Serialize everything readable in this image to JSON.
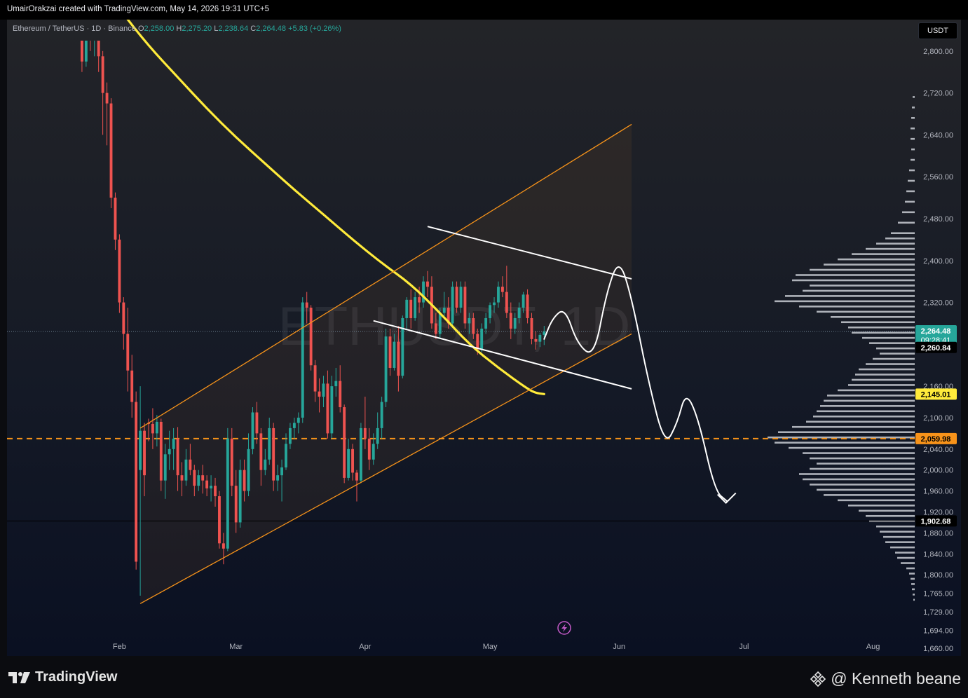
{
  "header": {
    "attribution": "UmairOrakzai created with TradingView.com, May 14, 2026 19:31 UTC+5"
  },
  "legend": {
    "symbol": "Ethereum / TetherUS · 1D · Binance",
    "o_label": "O",
    "o_value": "2,258.00",
    "h_label": "H",
    "h_value": "2,275.20",
    "l_label": "L",
    "l_value": "2,238.64",
    "c_label": "C",
    "c_value": "2,264.48",
    "change": "+5.83 (+0.26%)"
  },
  "currency": "USDT",
  "watermark": "ETHUSDT, 1D",
  "footer": {
    "brand": "TradingView",
    "credit": "@ Kenneth beane"
  },
  "colors": {
    "up": "#26a69a",
    "down": "#ef5350",
    "ma": "#ffeb3b",
    "channel": "#f7931a",
    "level": "#f7931a",
    "current": "#26a69a"
  },
  "chart_data": {
    "type": "candlestick",
    "symbol": "ETHUSDT",
    "interval": "1D",
    "ylim": [
      1645,
      2860
    ],
    "x_range": [
      "Jan 5",
      "Aug 11"
    ],
    "y_ticks": [
      "2,800.00",
      "2,720.00",
      "2,640.00",
      "2,560.00",
      "2,480.00",
      "2,400.00",
      "2,320.00",
      "2,160.00",
      "2,100.00",
      "2,040.00",
      "2,000.00",
      "1,960.00",
      "1,920.00",
      "1,880.00",
      "1,840.00",
      "1,800.00",
      "1,765.00",
      "1,729.00",
      "1,694.00",
      "1,660.00"
    ],
    "x_ticks": [
      "Feb",
      "Mar",
      "Apr",
      "May",
      "Jun",
      "Jul",
      "Aug"
    ],
    "price_labels": [
      {
        "value": "2,264.48",
        "sub": "09:28:41",
        "kind": "current"
      },
      {
        "value": "2,260.84",
        "kind": "black"
      },
      {
        "value": "2,145.01",
        "kind": "ma"
      },
      {
        "value": "2,059.98",
        "kind": "level"
      },
      {
        "value": "1,902.68",
        "kind": "black"
      }
    ],
    "levels": {
      "dashed": 2059.98,
      "solid": 1902.68,
      "current": 2264.48
    },
    "candles": [
      [
        "Jan 20",
        2870,
        2930,
        2840,
        2900
      ],
      [
        "Jan 21",
        2900,
        2940,
        2820,
        2850
      ],
      [
        "Jan 22",
        2850,
        2900,
        2830,
        2880
      ],
      [
        "Jan 23",
        2880,
        2920,
        2760,
        2780
      ],
      [
        "Jan 24",
        2780,
        2900,
        2770,
        2880
      ],
      [
        "Jan 25",
        2880,
        2900,
        2800,
        2820
      ],
      [
        "Jan 26",
        2820,
        2880,
        2790,
        2860
      ],
      [
        "Jan 27",
        2860,
        2870,
        2760,
        2790
      ],
      [
        "Jan 28",
        2790,
        2800,
        2640,
        2720
      ],
      [
        "Jan 29",
        2720,
        2740,
        2620,
        2700
      ],
      [
        "Jan 30",
        2700,
        2710,
        2500,
        2520
      ],
      [
        "Jan 31",
        2520,
        2530,
        2420,
        2440
      ],
      [
        "Feb 1",
        2440,
        2450,
        2300,
        2320
      ],
      [
        "Feb 2",
        2320,
        2330,
        2230,
        2260
      ],
      [
        "Feb 3",
        2260,
        2310,
        2150,
        2190
      ],
      [
        "Feb 4",
        2190,
        2220,
        2100,
        2130
      ],
      [
        "Feb 5",
        2130,
        2150,
        1810,
        1825
      ],
      [
        "Feb 6",
        2000,
        2160,
        1760,
        2075
      ],
      [
        "Feb 7",
        2075,
        2090,
        1950,
        1990
      ],
      [
        "Feb 8",
        2090,
        2098,
        2055,
        2088
      ],
      [
        "Feb 9",
        2088,
        2118,
        2040,
        2070
      ],
      [
        "Feb 10",
        2070,
        2105,
        2045,
        2092
      ],
      [
        "Feb 11",
        2092,
        2098,
        1960,
        1980
      ],
      [
        "Feb 12",
        1980,
        2050,
        1945,
        2030
      ],
      [
        "Feb 13",
        2030,
        2075,
        2000,
        2040
      ],
      [
        "Feb 14",
        2040,
        2080,
        2000,
        2060
      ],
      [
        "Feb 15",
        2060,
        2082,
        1960,
        1990
      ],
      [
        "Feb 16",
        1990,
        2015,
        1950,
        1980
      ],
      [
        "Feb 17",
        1980,
        2040,
        1970,
        2020
      ],
      [
        "Feb 18",
        2020,
        2050,
        1990,
        2000
      ],
      [
        "Feb 19",
        2000,
        2010,
        1950,
        1970
      ],
      [
        "Feb 20",
        1970,
        2000,
        1960,
        1990
      ],
      [
        "Feb 21",
        1990,
        2010,
        1955,
        1980
      ],
      [
        "Feb 22",
        1980,
        1990,
        1950,
        1965
      ],
      [
        "Feb 23",
        1965,
        1990,
        1940,
        1970
      ],
      [
        "Feb 24",
        1970,
        1985,
        1930,
        1950
      ],
      [
        "Feb 25",
        1950,
        1960,
        1850,
        1860
      ],
      [
        "Feb 26",
        1860,
        1880,
        1820,
        1850
      ],
      [
        "Feb 27",
        1850,
        2080,
        1845,
        2060
      ],
      [
        "Feb 28",
        2060,
        2080,
        1950,
        1970
      ],
      [
        "Mar 1",
        1970,
        2000,
        1880,
        1900
      ],
      [
        "Mar 2",
        1900,
        2020,
        1890,
        2000
      ],
      [
        "Mar 3",
        2000,
        2020,
        1940,
        1960
      ],
      [
        "Mar 4",
        1960,
        2070,
        1950,
        2040
      ],
      [
        "Mar 5",
        2040,
        2120,
        2030,
        2110
      ],
      [
        "Mar 6",
        2110,
        2130,
        2050,
        2070
      ],
      [
        "Mar 7",
        2070,
        2080,
        1970,
        2000
      ],
      [
        "Mar 8",
        2000,
        2040,
        1990,
        2020
      ],
      [
        "Mar 9",
        2020,
        2100,
        2010,
        2080
      ],
      [
        "Mar 10",
        2080,
        2090,
        1960,
        1980
      ],
      [
        "Mar 11",
        1980,
        2010,
        1960,
        1990
      ],
      [
        "Mar 12",
        1990,
        2020,
        1940,
        2005
      ],
      [
        "Mar 13",
        2005,
        2070,
        2000,
        2050
      ],
      [
        "Mar 14",
        2050,
        2090,
        2040,
        2080
      ],
      [
        "Mar 15",
        2080,
        2100,
        2060,
        2090
      ],
      [
        "Mar 16",
        2090,
        2110,
        2070,
        2100
      ],
      [
        "Mar 17",
        2100,
        2330,
        2090,
        2320
      ],
      [
        "Mar 18",
        2320,
        2340,
        2280,
        2310
      ],
      [
        "Mar 19",
        2310,
        2315,
        2190,
        2200
      ],
      [
        "Mar 20",
        2200,
        2210,
        2130,
        2150
      ],
      [
        "Mar 21",
        2150,
        2175,
        2110,
        2140
      ],
      [
        "Mar 22",
        2140,
        2180,
        2120,
        2165
      ],
      [
        "Mar 23",
        2165,
        2190,
        2060,
        2070
      ],
      [
        "Mar 24",
        2070,
        2180,
        2060,
        2160
      ],
      [
        "Mar 25",
        2160,
        2195,
        2140,
        2170
      ],
      [
        "Mar 26",
        2170,
        2200,
        2110,
        2120
      ],
      [
        "Mar 27",
        2120,
        2125,
        1975,
        1985
      ],
      [
        "Mar 28",
        1985,
        2060,
        1980,
        2040
      ],
      [
        "Mar 29",
        2040,
        2050,
        1980,
        1995
      ],
      [
        "Mar 30",
        1995,
        2000,
        1940,
        1980
      ],
      [
        "Mar 31",
        1980,
        2090,
        1975,
        2080
      ],
      [
        "Apr 1",
        2080,
        2140,
        2040,
        2060
      ],
      [
        "Apr 2",
        2060,
        2080,
        2000,
        2020
      ],
      [
        "Apr 3",
        2020,
        2070,
        2010,
        2050
      ],
      [
        "Apr 4",
        2050,
        2110,
        2040,
        2080
      ],
      [
        "Apr 5",
        2080,
        2140,
        2060,
        2130
      ],
      [
        "Apr 6",
        2130,
        2270,
        2120,
        2255
      ],
      [
        "Apr 7",
        2255,
        2270,
        2180,
        2195
      ],
      [
        "Apr 8",
        2195,
        2260,
        2190,
        2245
      ],
      [
        "Apr 9",
        2245,
        2275,
        2150,
        2180
      ],
      [
        "Apr 10",
        2180,
        2295,
        2175,
        2290
      ],
      [
        "Apr 11",
        2290,
        2330,
        2270,
        2325
      ],
      [
        "Apr 12",
        2325,
        2345,
        2270,
        2290
      ],
      [
        "Apr 13",
        2290,
        2340,
        2285,
        2330
      ],
      [
        "Apr 14",
        2330,
        2350,
        2300,
        2320
      ],
      [
        "Apr 15",
        2320,
        2370,
        2310,
        2360
      ],
      [
        "Apr 16",
        2360,
        2380,
        2330,
        2350
      ],
      [
        "Apr 17",
        2350,
        2370,
        2270,
        2280
      ],
      [
        "Apr 18",
        2280,
        2300,
        2250,
        2260
      ],
      [
        "Apr 19",
        2260,
        2310,
        2250,
        2300
      ],
      [
        "Apr 20",
        2300,
        2340,
        2290,
        2310
      ],
      [
        "Apr 21",
        2310,
        2330,
        2270,
        2280
      ],
      [
        "Apr 22",
        2280,
        2360,
        2275,
        2350
      ],
      [
        "Apr 23",
        2350,
        2360,
        2300,
        2310
      ],
      [
        "Apr 24",
        2310,
        2360,
        2300,
        2350
      ],
      [
        "Apr 25",
        2350,
        2360,
        2270,
        2280
      ],
      [
        "Apr 26",
        2280,
        2300,
        2260,
        2290
      ],
      [
        "Apr 27",
        2290,
        2300,
        2250,
        2260
      ],
      [
        "Apr 28",
        2260,
        2270,
        2220,
        2230
      ],
      [
        "Apr 29",
        2230,
        2280,
        2225,
        2270
      ],
      [
        "Apr 30",
        2270,
        2300,
        2260,
        2290
      ],
      [
        "May 1",
        2290,
        2320,
        2280,
        2315
      ],
      [
        "May 2",
        2315,
        2330,
        2300,
        2320
      ],
      [
        "May 3",
        2320,
        2360,
        2310,
        2350
      ],
      [
        "May 4",
        2350,
        2370,
        2330,
        2340
      ],
      [
        "May 5",
        2340,
        2390,
        2290,
        2300
      ],
      [
        "May 6",
        2300,
        2320,
        2250,
        2270
      ],
      [
        "May 7",
        2270,
        2300,
        2260,
        2290
      ],
      [
        "May 8",
        2290,
        2320,
        2280,
        2310
      ],
      [
        "May 9",
        2310,
        2340,
        2300,
        2335
      ],
      [
        "May 10",
        2335,
        2345,
        2280,
        2290
      ],
      [
        "May 11",
        2290,
        2300,
        2240,
        2250
      ],
      [
        "May 12",
        2250,
        2265,
        2230,
        2245
      ],
      [
        "May 13",
        2245,
        2262,
        2235,
        2258
      ],
      [
        "May 14",
        2258,
        2275.2,
        2238.64,
        2264.48
      ]
    ],
    "ma": [
      [
        "Jan 25",
        2960
      ],
      [
        "Feb 1",
        2880
      ],
      [
        "Feb 8",
        2810
      ],
      [
        "Feb 15",
        2750
      ],
      [
        "Feb 22",
        2690
      ],
      [
        "Mar 1",
        2635
      ],
      [
        "Mar 8",
        2585
      ],
      [
        "Mar 15",
        2535
      ],
      [
        "Mar 22",
        2488
      ],
      [
        "Mar 29",
        2440
      ],
      [
        "Apr 5",
        2395
      ],
      [
        "Apr 12",
        2355
      ],
      [
        "Apr 19",
        2300
      ],
      [
        "Apr 26",
        2240
      ],
      [
        "May 3",
        2195
      ],
      [
        "May 10",
        2155
      ],
      [
        "May 12",
        2147
      ],
      [
        "May 14",
        2145.01
      ]
    ],
    "channel": {
      "lower": [
        [
          "Feb 6",
          1745
        ],
        [
          "Jun 4",
          2260
        ]
      ],
      "upper": [
        [
          "Feb 6",
          2080
        ],
        [
          "Jun 4",
          2660
        ]
      ]
    },
    "flag": {
      "upper": [
        [
          "Apr 16",
          2465
        ],
        [
          "Jun 4",
          2365
        ]
      ],
      "lower": [
        [
          "Apr 3",
          2285
        ],
        [
          "Jun 4",
          2155
        ]
      ]
    },
    "projection": [
      [
        "May 14",
        2250
      ],
      [
        "May 16",
        2290
      ],
      [
        "May 19",
        2310
      ],
      [
        "May 22",
        2240
      ],
      [
        "May 26",
        2215
      ],
      [
        "May 29",
        2340
      ],
      [
        "Jun 1",
        2405
      ],
      [
        "Jun 4",
        2330
      ],
      [
        "Jun 8",
        2170
      ],
      [
        "Jun 12",
        2045
      ],
      [
        "Jun 15",
        2090
      ],
      [
        "Jun 17",
        2150
      ],
      [
        "Jun 20",
        2100
      ],
      [
        "Jun 24",
        1960
      ],
      [
        "Jun 27",
        1940
      ]
    ],
    "volume_profile": [
      [
        2710,
        3
      ],
      [
        2690,
        4
      ],
      [
        2670,
        5
      ],
      [
        2650,
        6
      ],
      [
        2630,
        6
      ],
      [
        2610,
        5
      ],
      [
        2590,
        6
      ],
      [
        2570,
        8
      ],
      [
        2550,
        10
      ],
      [
        2530,
        12
      ],
      [
        2510,
        14
      ],
      [
        2490,
        18
      ],
      [
        2470,
        24
      ],
      [
        2450,
        34
      ],
      [
        2440,
        42
      ],
      [
        2430,
        55
      ],
      [
        2420,
        70
      ],
      [
        2410,
        90
      ],
      [
        2400,
        110
      ],
      [
        2390,
        130
      ],
      [
        2380,
        150
      ],
      [
        2370,
        170
      ],
      [
        2360,
        175
      ],
      [
        2350,
        150
      ],
      [
        2340,
        160
      ],
      [
        2330,
        185
      ],
      [
        2320,
        200
      ],
      [
        2310,
        165
      ],
      [
        2300,
        140
      ],
      [
        2290,
        120
      ],
      [
        2280,
        105
      ],
      [
        2270,
        95
      ],
      [
        2260,
        90
      ],
      [
        2250,
        75
      ],
      [
        2240,
        65
      ],
      [
        2230,
        55
      ],
      [
        2220,
        50
      ],
      [
        2210,
        60
      ],
      [
        2200,
        70
      ],
      [
        2190,
        80
      ],
      [
        2180,
        85
      ],
      [
        2170,
        90
      ],
      [
        2160,
        95
      ],
      [
        2150,
        110
      ],
      [
        2140,
        125
      ],
      [
        2130,
        130
      ],
      [
        2120,
        135
      ],
      [
        2110,
        140
      ],
      [
        2100,
        145
      ],
      [
        2090,
        155
      ],
      [
        2080,
        175
      ],
      [
        2070,
        195
      ],
      [
        2060,
        210
      ],
      [
        2050,
        200
      ],
      [
        2040,
        180
      ],
      [
        2030,
        160
      ],
      [
        2020,
        150
      ],
      [
        2010,
        140
      ],
      [
        2000,
        150
      ],
      [
        1990,
        165
      ],
      [
        1980,
        160
      ],
      [
        1970,
        150
      ],
      [
        1960,
        140
      ],
      [
        1950,
        130
      ],
      [
        1940,
        110
      ],
      [
        1930,
        95
      ],
      [
        1920,
        80
      ],
      [
        1910,
        70
      ],
      [
        1900,
        65
      ],
      [
        1890,
        55
      ],
      [
        1880,
        50
      ],
      [
        1870,
        45
      ],
      [
        1860,
        42
      ],
      [
        1850,
        35
      ],
      [
        1840,
        28
      ],
      [
        1830,
        25
      ],
      [
        1820,
        20
      ],
      [
        1810,
        12
      ],
      [
        1800,
        8
      ],
      [
        1790,
        6
      ],
      [
        1780,
        5
      ],
      [
        1770,
        4
      ],
      [
        1760,
        3
      ],
      [
        1750,
        2
      ]
    ]
  }
}
